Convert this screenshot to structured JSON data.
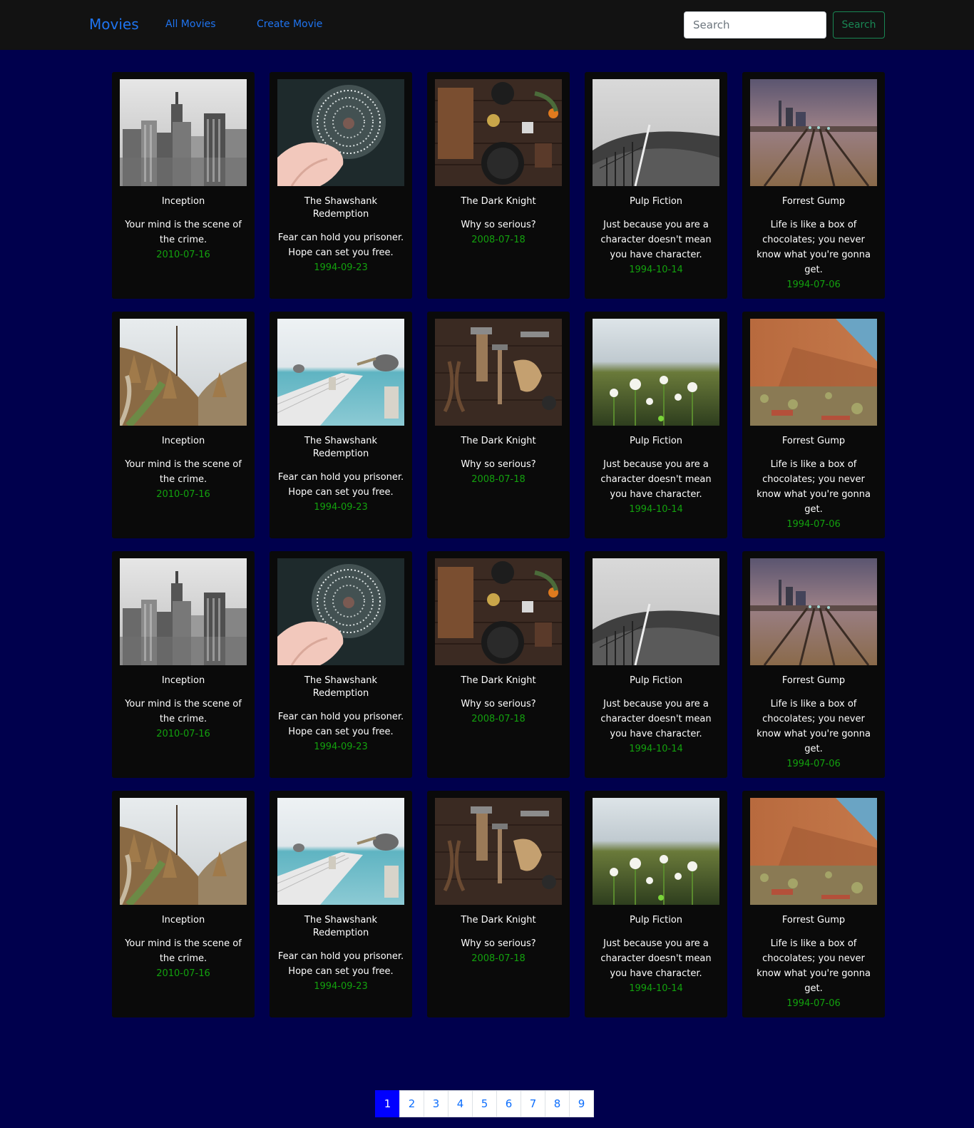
{
  "navbar": {
    "brand": "Movies",
    "links": [
      "All Movies",
      "Create Movie"
    ],
    "search_placeholder": "Search",
    "search_button": "Search"
  },
  "cards": [
    {
      "title": "Inception",
      "tagline": "Your mind is the scene of the crime.",
      "date": "2010-07-16",
      "image": "city"
    },
    {
      "title": "The Shawshank Redemption",
      "tagline": "Fear can hold you prisoner. Hope can set you free.",
      "date": "1994-09-23",
      "image": "dandelion-hand"
    },
    {
      "title": "The Dark Knight",
      "tagline": "Why so serious?",
      "date": "2008-07-18",
      "image": "kitchen-tools"
    },
    {
      "title": "Pulp Fiction",
      "tagline": "Just because you are a character doesn't mean you have character.",
      "date": "1994-10-14",
      "image": "hill-fence"
    },
    {
      "title": "Forrest Gump",
      "tagline": "Life is like a box of chocolates; you never know what you're gonna get.",
      "date": "1994-07-06",
      "image": "railway"
    },
    {
      "title": "Inception",
      "tagline": "Your mind is the scene of the crime.",
      "date": "2010-07-16",
      "image": "forest-path"
    },
    {
      "title": "The Shawshank Redemption",
      "tagline": "Fear can hold you prisoner. Hope can set you free.",
      "date": "1994-09-23",
      "image": "pelican-pier"
    },
    {
      "title": "The Dark Knight",
      "tagline": "Why so serious?",
      "date": "2008-07-18",
      "image": "workshop-tools"
    },
    {
      "title": "Pulp Fiction",
      "tagline": "Just because you are a character doesn't mean you have character.",
      "date": "1994-10-14",
      "image": "dandelion-field"
    },
    {
      "title": "Forrest Gump",
      "tagline": "Life is like a box of chocolates; you never know what you're gonna get.",
      "date": "1994-07-06",
      "image": "desert-rock"
    },
    {
      "title": "Inception",
      "tagline": "Your mind is the scene of the crime.",
      "date": "2010-07-16",
      "image": "city"
    },
    {
      "title": "The Shawshank Redemption",
      "tagline": "Fear can hold you prisoner. Hope can set you free.",
      "date": "1994-09-23",
      "image": "dandelion-hand"
    },
    {
      "title": "The Dark Knight",
      "tagline": "Why so serious?",
      "date": "2008-07-18",
      "image": "kitchen-tools"
    },
    {
      "title": "Pulp Fiction",
      "tagline": "Just because you are a character doesn't mean you have character.",
      "date": "1994-10-14",
      "image": "hill-fence"
    },
    {
      "title": "Forrest Gump",
      "tagline": "Life is like a box of chocolates; you never know what you're gonna get.",
      "date": "1994-07-06",
      "image": "railway"
    },
    {
      "title": "Inception",
      "tagline": "Your mind is the scene of the crime.",
      "date": "2010-07-16",
      "image": "forest-path"
    },
    {
      "title": "The Shawshank Redemption",
      "tagline": "Fear can hold you prisoner. Hope can set you free.",
      "date": "1994-09-23",
      "image": "pelican-pier"
    },
    {
      "title": "The Dark Knight",
      "tagline": "Why so serious?",
      "date": "2008-07-18",
      "image": "workshop-tools"
    },
    {
      "title": "Pulp Fiction",
      "tagline": "Just because you are a character doesn't mean you have character.",
      "date": "1994-10-14",
      "image": "dandelion-field"
    },
    {
      "title": "Forrest Gump",
      "tagline": "Life is like a box of chocolates; you never know what you're gonna get.",
      "date": "1994-07-06",
      "image": "desert-rock"
    }
  ],
  "pagination": {
    "pages": [
      "1",
      "2",
      "3",
      "4",
      "5",
      "6",
      "7",
      "8",
      "9"
    ],
    "active": "1"
  },
  "colors": {
    "page_background": "#00004d",
    "navbar_background": "#121212",
    "card_background": "#0a0a0a",
    "link": "#1f74f0",
    "date": "#13a10e",
    "search_button": "#198754",
    "active_page": "#0000ff"
  }
}
